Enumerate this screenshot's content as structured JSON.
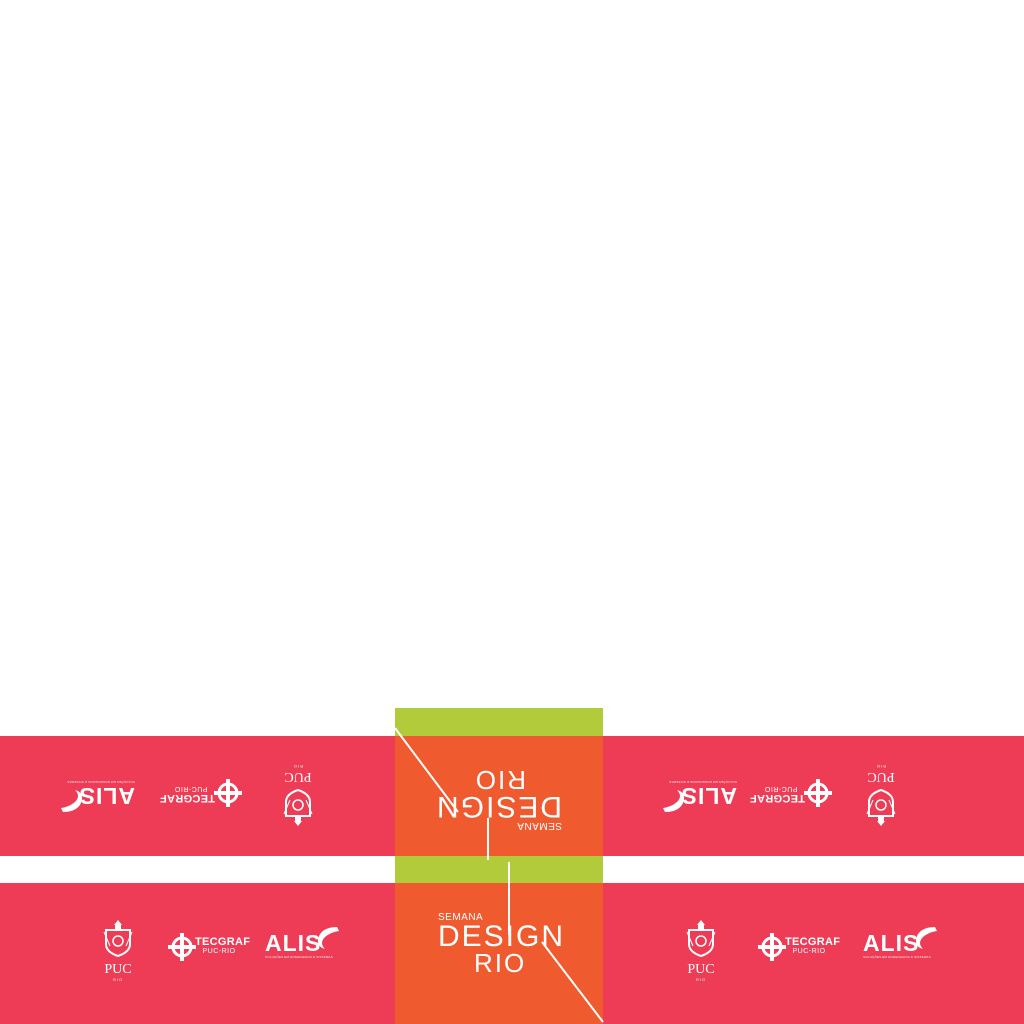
{
  "colors": {
    "background": "#ffffff",
    "band_red": "#ee3c57",
    "accent_green": "#b2cb3b",
    "panel_orange": "#ef5a2f",
    "logo_white": "#ffffff"
  },
  "badge": {
    "semana": "SEMANA",
    "design": "DESIGN",
    "rio": "RIO"
  },
  "logos": {
    "alis": {
      "word": "ALIS",
      "tagline": "SOLUÇÕES EM ENGENHARIA E SISTEMAS"
    },
    "tecgraf": {
      "word": "TECGRAF",
      "sub": "PUC-RIO"
    },
    "puc": {
      "word": "PUC",
      "sub": "RIO"
    }
  }
}
